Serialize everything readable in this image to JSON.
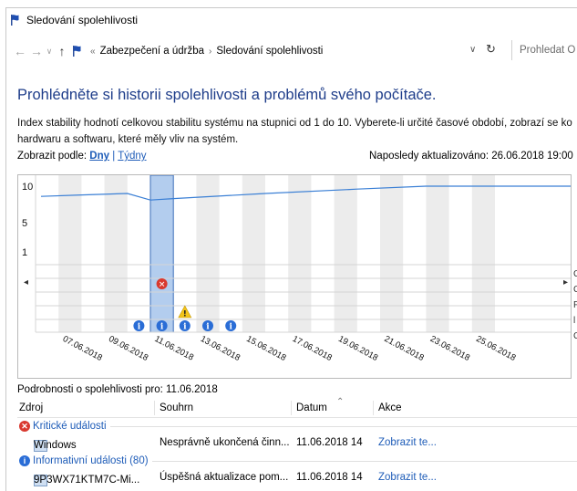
{
  "window": {
    "title": "Sledování spolehlivosti"
  },
  "address": {
    "crumbs": [
      "Zabezpečení a údržba",
      "Sledování spolehlivosti"
    ],
    "search_placeholder": "Prohledat O"
  },
  "heading": "Prohlédněte si historii spolehlivosti a problémů svého počítače.",
  "description": "Index stability hodnotí celkovou stabilitu systému na stupnici od 1 do 10. Vyberete-li určité časové období, zobrazí se ko hardwaru a softwaru, které měly vliv na systém.",
  "view_by": {
    "label": "Zobrazit podle:",
    "days": "Dny",
    "separator": "|",
    "weeks": "Týdny"
  },
  "last_updated": "Naposledy aktualizováno: 26.06.2018 19:00",
  "chart_data": {
    "type": "line",
    "y_ticks": [
      "10",
      "5",
      "1"
    ],
    "ylim": [
      1,
      10
    ],
    "x_labels": [
      "07.06.2018",
      "09.06.2018",
      "11.06.2018",
      "13.06.2018",
      "15.06.2018",
      "17.06.2018",
      "19.06.2018",
      "21.06.2018",
      "23.06.2018",
      "25.06.2018"
    ],
    "selected_date": "11.06.2018",
    "stability_index": [
      {
        "day": "06.06.2018",
        "value": 8.6
      },
      {
        "day": "08.06.2018",
        "value": 8.8
      },
      {
        "day": "10.06.2018",
        "value": 9.0
      },
      {
        "day": "11.06.2018",
        "value": 8.1
      },
      {
        "day": "12.06.2018",
        "value": 8.3
      },
      {
        "day": "16.06.2018",
        "value": 9.0
      },
      {
        "day": "20.06.2018",
        "value": 9.6
      },
      {
        "day": "23.06.2018",
        "value": 10.0
      },
      {
        "day": "26.06.2018",
        "value": 10.0
      }
    ],
    "events": [
      {
        "day": "11.06.2018",
        "kind": "critical"
      },
      {
        "day": "12.06.2018",
        "kind": "warning"
      },
      {
        "day": "10.06.2018",
        "kind": "info"
      },
      {
        "day": "11.06.2018",
        "kind": "info"
      },
      {
        "day": "12.06.2018",
        "kind": "info"
      },
      {
        "day": "13.06.2018",
        "kind": "info"
      },
      {
        "day": "14.06.2018",
        "kind": "info"
      }
    ],
    "colors": {
      "line": "#3a7fd5",
      "selected": "#b3cdee",
      "grid": "#d5d5d5",
      "stripe": "#ececec"
    }
  },
  "side_info_letters": [
    "C",
    "C",
    "F",
    "l",
    "C"
  ],
  "details": {
    "label": "Podrobnosti o spolehlivosti pro: 11.06.2018",
    "columns": [
      "Zdroj",
      "Souhrn",
      "Datum",
      "Akce"
    ],
    "groups": [
      {
        "title": "Kritické události",
        "rows": [
          {
            "source": "Windows",
            "summary": "Nesprávně ukončená činn...",
            "date": "11.06.2018 14",
            "action": "Zobrazit te..."
          }
        ]
      },
      {
        "title": "Informativní události (80)",
        "rows": [
          {
            "source": "9P3WX71KTM7C-Mi...",
            "summary": "Úspěšná aktualizace pom...",
            "date": "11.06.2018 14",
            "action": "Zobrazit te..."
          }
        ]
      }
    ]
  }
}
